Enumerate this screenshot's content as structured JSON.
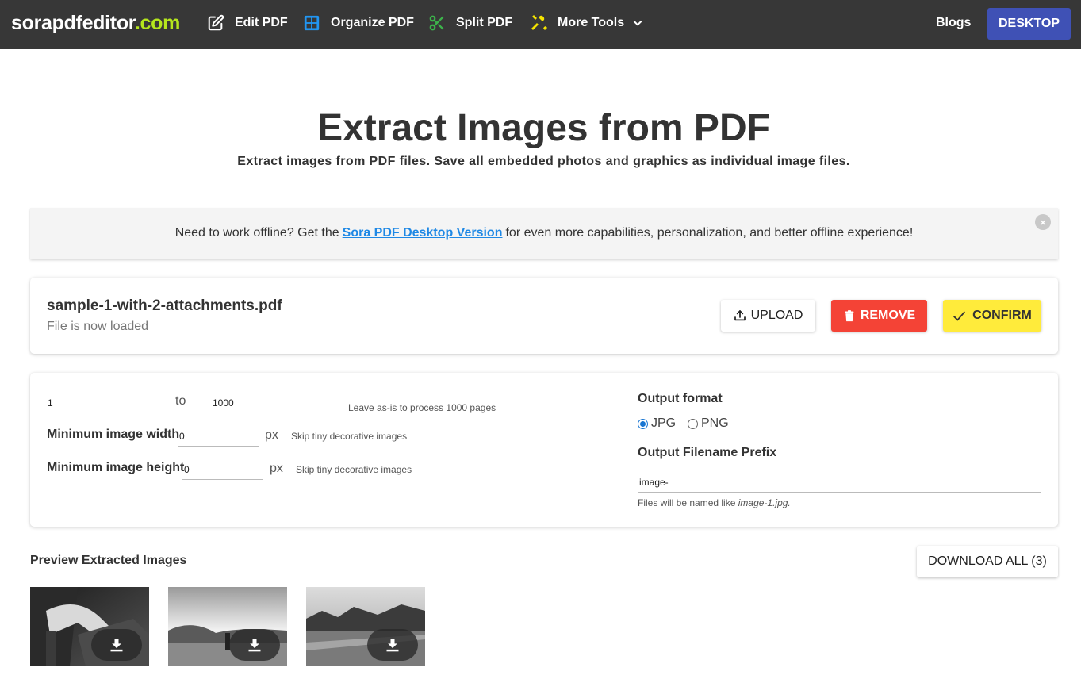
{
  "nav": {
    "brand_main": "sorapdfeditor",
    "brand_tld": ".com",
    "items": [
      {
        "label": "Edit PDF",
        "icon": "edit-icon"
      },
      {
        "label": "Organize PDF",
        "icon": "grid-icon"
      },
      {
        "label": "Split PDF",
        "icon": "scissors-icon"
      },
      {
        "label": "More Tools",
        "icon": "tools-icon"
      }
    ],
    "blogs": "Blogs",
    "desktop": "DESKTOP"
  },
  "header": {
    "title": "Extract Images from PDF",
    "subtitle": "Extract images from PDF files. Save all embedded photos and graphics as individual image files."
  },
  "banner": {
    "text_before": "Need to work offline? Get the",
    "link": "Sora PDF Desktop Version",
    "text_after": "for even more capabilities, personalization, and better offline experience!",
    "close": "×"
  },
  "file": {
    "name": "sample-1-with-2-attachments.pdf",
    "status": "File is now loaded",
    "upload": "UPLOAD",
    "remove": "REMOVE",
    "confirm": "CONFIRM"
  },
  "options": {
    "page_from": "1",
    "to_label": "to",
    "page_to": "1000",
    "page_hint": "Leave as-is to process 1000 pages",
    "min_width_label": "Minimum image width",
    "min_width_value": "0",
    "min_height_label": "Minimum image height",
    "min_height_value": "0",
    "px": "px",
    "skip_hint": "Skip tiny decorative images",
    "output_format_label": "Output format",
    "format_jpg": "JPG",
    "format_png": "PNG",
    "prefix_label": "Output Filename Prefix",
    "prefix_value": "image-",
    "files_named_text": "Files will be named like",
    "files_named_example": "image-1.jpg."
  },
  "preview": {
    "title": "Preview Extracted Images",
    "download_all": "DOWNLOAD ALL (3)"
  },
  "colors": {
    "navbar": "#373737",
    "brand_accent": "#b5e61d",
    "desktop_button": "#3f51b5",
    "remove_button": "#f44336",
    "confirm_button": "#ffeb3b",
    "link": "#1e88e5"
  }
}
